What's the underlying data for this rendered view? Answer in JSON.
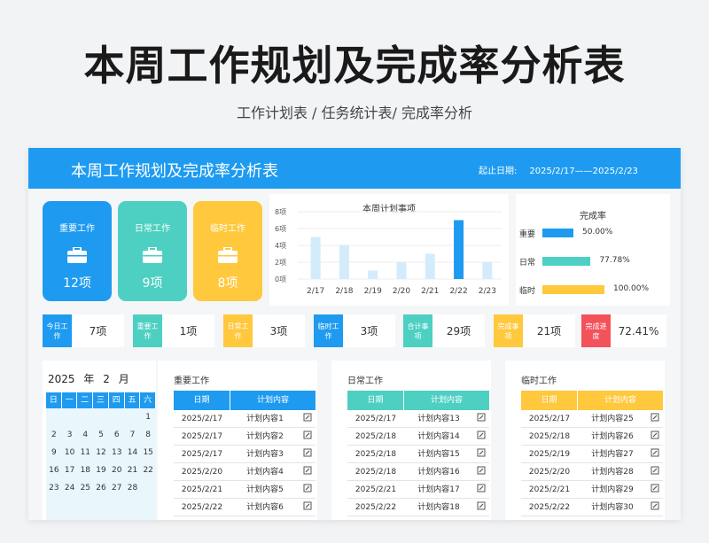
{
  "page": {
    "title": "本周工作规划及完成率分析表",
    "subtitle": "工作计划表  /  任务统计表/ 完成率分析"
  },
  "sheet": {
    "title": "本周工作规划及完成率分析表",
    "date_label": "起止日期:",
    "date_range": "2025/2/17——2025/2/23"
  },
  "cards": [
    {
      "label": "重要工作",
      "value": "12项",
      "color": "#1e9bf0",
      "icon": "briefcase-icon"
    },
    {
      "label": "日常工作",
      "value": "9项",
      "color": "#4dd0c2",
      "icon": "briefcase-icon"
    },
    {
      "label": "临时工作",
      "value": "8项",
      "color": "#ffc83d",
      "icon": "briefcase-icon"
    }
  ],
  "chart_data": [
    {
      "type": "bar",
      "title": "本周计划事项",
      "categories": [
        "2/17",
        "2/18",
        "2/19",
        "2/20",
        "2/21",
        "2/22",
        "2/23"
      ],
      "values": [
        5,
        4,
        1,
        2,
        3,
        7,
        2
      ],
      "highlight_index": 5,
      "y_ticks": [
        "8项",
        "6项",
        "4项",
        "2项",
        "0项"
      ],
      "ylim": [
        0,
        8
      ],
      "bar_color": "#d4ebfb",
      "highlight_color": "#1e9bf0"
    },
    {
      "type": "bar",
      "title": "完成率",
      "categories": [
        "重要",
        "日常",
        "临时"
      ],
      "values": [
        50.0,
        77.78,
        100.0
      ],
      "value_labels": [
        "50.00%",
        "77.78%",
        "100.00%"
      ],
      "colors": [
        "#1e9bf0",
        "#4dd0c2",
        "#ffc83d"
      ],
      "xlim": [
        0,
        100
      ]
    }
  ],
  "stats": [
    {
      "label": "今日工作",
      "value": "7项",
      "color": "#1e9bf0"
    },
    {
      "label": "重要工作",
      "value": "1项",
      "color": "#4dd0c2"
    },
    {
      "label": "日常工作",
      "value": "3项",
      "color": "#ffc83d"
    },
    {
      "label": "临时工作",
      "value": "3项",
      "color": "#1e9bf0"
    },
    {
      "label": "合计事项",
      "value": "29项",
      "color": "#4dd0c2"
    },
    {
      "label": "完成事项",
      "value": "21项",
      "color": "#ffc83d"
    },
    {
      "label": "完成进度",
      "value": "72.41%",
      "color": "#f4525a"
    }
  ],
  "calendar": {
    "year": "2025",
    "year_unit": "年",
    "month": "2",
    "month_unit": "月",
    "weekdays": [
      "日",
      "一",
      "二",
      "三",
      "四",
      "五",
      "六"
    ],
    "weeks": [
      [
        "",
        "",
        "",
        "",
        "",
        "",
        "1"
      ],
      [
        "2",
        "3",
        "4",
        "5",
        "6",
        "7",
        "8"
      ],
      [
        "9",
        "10",
        "11",
        "12",
        "13",
        "14",
        "15"
      ],
      [
        "16",
        "17",
        "18",
        "19",
        "20",
        "21",
        "22"
      ],
      [
        "23",
        "24",
        "25",
        "26",
        "27",
        "28",
        ""
      ]
    ]
  },
  "tables": [
    {
      "title": "重要工作",
      "color": "#1e9bf0",
      "headers": [
        "日期",
        "计划内容"
      ],
      "rows": [
        [
          "2025/2/17",
          "计划内容1"
        ],
        [
          "2025/2/17",
          "计划内容2"
        ],
        [
          "2025/2/17",
          "计划内容3"
        ],
        [
          "2025/2/20",
          "计划内容4"
        ],
        [
          "2025/2/21",
          "计划内容5"
        ],
        [
          "2025/2/22",
          "计划内容6"
        ]
      ]
    },
    {
      "title": "日常工作",
      "color": "#4dd0c2",
      "headers": [
        "日期",
        "计划内容"
      ],
      "rows": [
        [
          "2025/2/17",
          "计划内容13"
        ],
        [
          "2025/2/18",
          "计划内容14"
        ],
        [
          "2025/2/18",
          "计划内容15"
        ],
        [
          "2025/2/18",
          "计划内容16"
        ],
        [
          "2025/2/21",
          "计划内容17"
        ],
        [
          "2025/2/22",
          "计划内容18"
        ]
      ]
    },
    {
      "title": "临时工作",
      "color": "#ffc83d",
      "headers": [
        "日期",
        "计划内容"
      ],
      "rows": [
        [
          "2025/2/17",
          "计划内容25"
        ],
        [
          "2025/2/18",
          "计划内容26"
        ],
        [
          "2025/2/19",
          "计划内容27"
        ],
        [
          "2025/2/20",
          "计划内容28"
        ],
        [
          "2025/2/21",
          "计划内容29"
        ],
        [
          "2025/2/22",
          "计划内容30"
        ]
      ]
    }
  ]
}
